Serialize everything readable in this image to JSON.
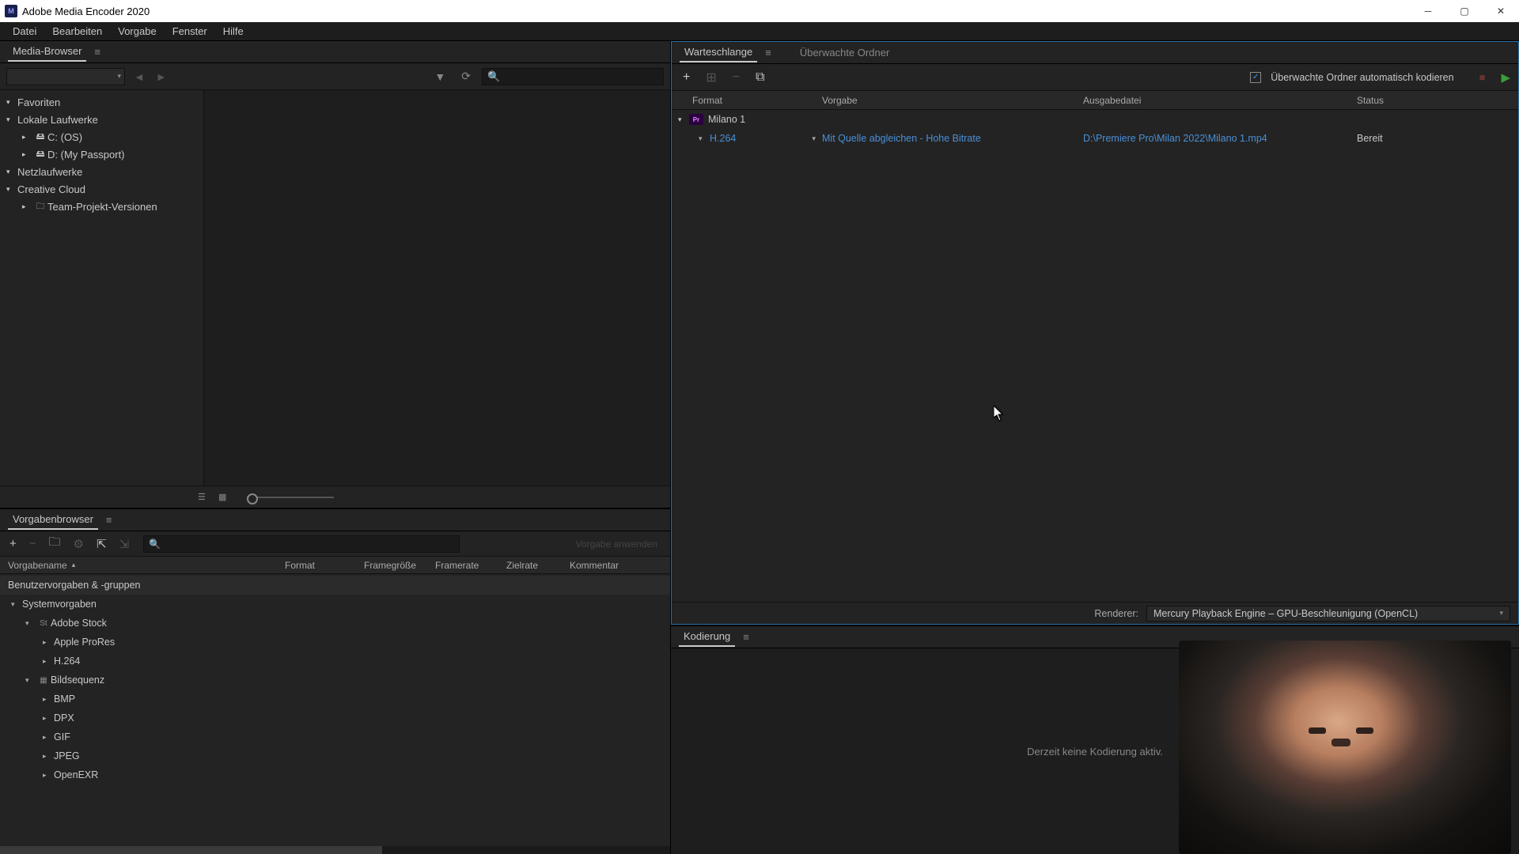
{
  "app": {
    "title": "Adobe Media Encoder 2020"
  },
  "menu": {
    "file": "Datei",
    "edit": "Bearbeiten",
    "preset": "Vorgabe",
    "window": "Fenster",
    "help": "Hilfe"
  },
  "media_browser": {
    "title": "Media-Browser",
    "tree": {
      "favorites": "Favoriten",
      "local_drives": "Lokale Laufwerke",
      "drive_c": "C: (OS)",
      "drive_d": "D: (My Passport)",
      "network": "Netzlaufwerke",
      "creative_cloud": "Creative Cloud",
      "team_projects": "Team-Projekt-Versionen"
    }
  },
  "preset_browser": {
    "title": "Vorgabenbrowser",
    "apply": "Vorgabe anwenden",
    "headers": {
      "name": "Vorgabename",
      "format": "Format",
      "framesize": "Framegröße",
      "framerate": "Framerate",
      "bitrate": "Zielrate",
      "comment": "Kommentar"
    },
    "groups": {
      "user": "Benutzervorgaben & -gruppen",
      "system": "Systemvorgaben",
      "adobe_stock": "Adobe Stock",
      "apple_prores": "Apple ProRes",
      "h264": "H.264",
      "image_seq": "Bildsequenz",
      "bmp": "BMP",
      "dpx": "DPX",
      "gif": "GIF",
      "jpeg": "JPEG",
      "openexr": "OpenEXR"
    }
  },
  "queue": {
    "tab_queue": "Warteschlange",
    "tab_watch": "Überwachte Ordner",
    "auto_encode": "Überwachte Ordner automatisch kodieren",
    "headers": {
      "format": "Format",
      "preset": "Vorgabe",
      "output": "Ausgabedatei",
      "status": "Status"
    },
    "job": {
      "name": "Milano 1",
      "format": "H.264",
      "preset": "Mit Quelle abgleichen - Hohe Bitrate",
      "output": "D:\\Premiere Pro\\Milan 2022\\Milano 1.mp4",
      "status": "Bereit"
    },
    "renderer_label": "Renderer:",
    "renderer_value": "Mercury Playback Engine – GPU-Beschleunigung (OpenCL)"
  },
  "encoding": {
    "title": "Kodierung",
    "idle": "Derzeit keine Kodierung aktiv."
  }
}
